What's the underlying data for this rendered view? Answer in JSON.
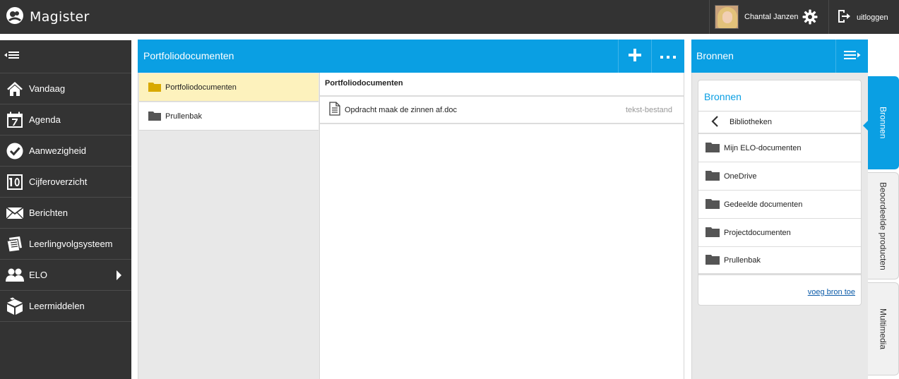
{
  "app": {
    "title": "Magister"
  },
  "header": {
    "user_name": "Chantal Janzen",
    "logout_label": "uitloggen"
  },
  "sidebar": {
    "items": [
      {
        "label": "Vandaag",
        "icon": "house-icon"
      },
      {
        "label": "Agenda",
        "icon": "calendar-icon"
      },
      {
        "label": "Aanwezigheid",
        "icon": "checkmark-icon"
      },
      {
        "label": "Cijferoverzicht",
        "icon": "grade-10-icon"
      },
      {
        "label": "Berichten",
        "icon": "envelope-icon"
      },
      {
        "label": "Leerlingvolgsysteem",
        "icon": "notebook-icon"
      },
      {
        "label": "ELO",
        "icon": "people-icon"
      },
      {
        "label": "Leermiddelen",
        "icon": "books-icon"
      }
    ]
  },
  "main": {
    "title": "Portfoliodocumenten",
    "folders": [
      {
        "label": "Portfoliodocumenten",
        "selected": true
      },
      {
        "label": "Prullenbak",
        "selected": false
      }
    ],
    "files_header": "Portfoliodocumenten",
    "files": [
      {
        "name": "Opdracht maak de zinnen af.doc",
        "type": "tekst-bestand"
      }
    ]
  },
  "bronnen": {
    "header_title": "Bronnen",
    "card_title": "Bronnen",
    "back_label": "Bibliotheken",
    "items": [
      {
        "label": "Mijn ELO-documenten"
      },
      {
        "label": "OneDrive"
      },
      {
        "label": "Gedeelde documenten"
      },
      {
        "label": "Projectdocumenten"
      },
      {
        "label": "Prullenbak"
      }
    ],
    "add_link": "voeg bron toe"
  },
  "tabs": [
    {
      "label": "Bronnen",
      "active": true
    },
    {
      "label": "Beoordeelde producten",
      "active": false
    },
    {
      "label": "Multimedia",
      "active": false
    }
  ],
  "colors": {
    "accent": "#0a9fe3",
    "dark": "#333333",
    "selected_folder": "#fdf2bd",
    "folder_yellow": "#d8a900",
    "folder_gray": "#555555"
  }
}
